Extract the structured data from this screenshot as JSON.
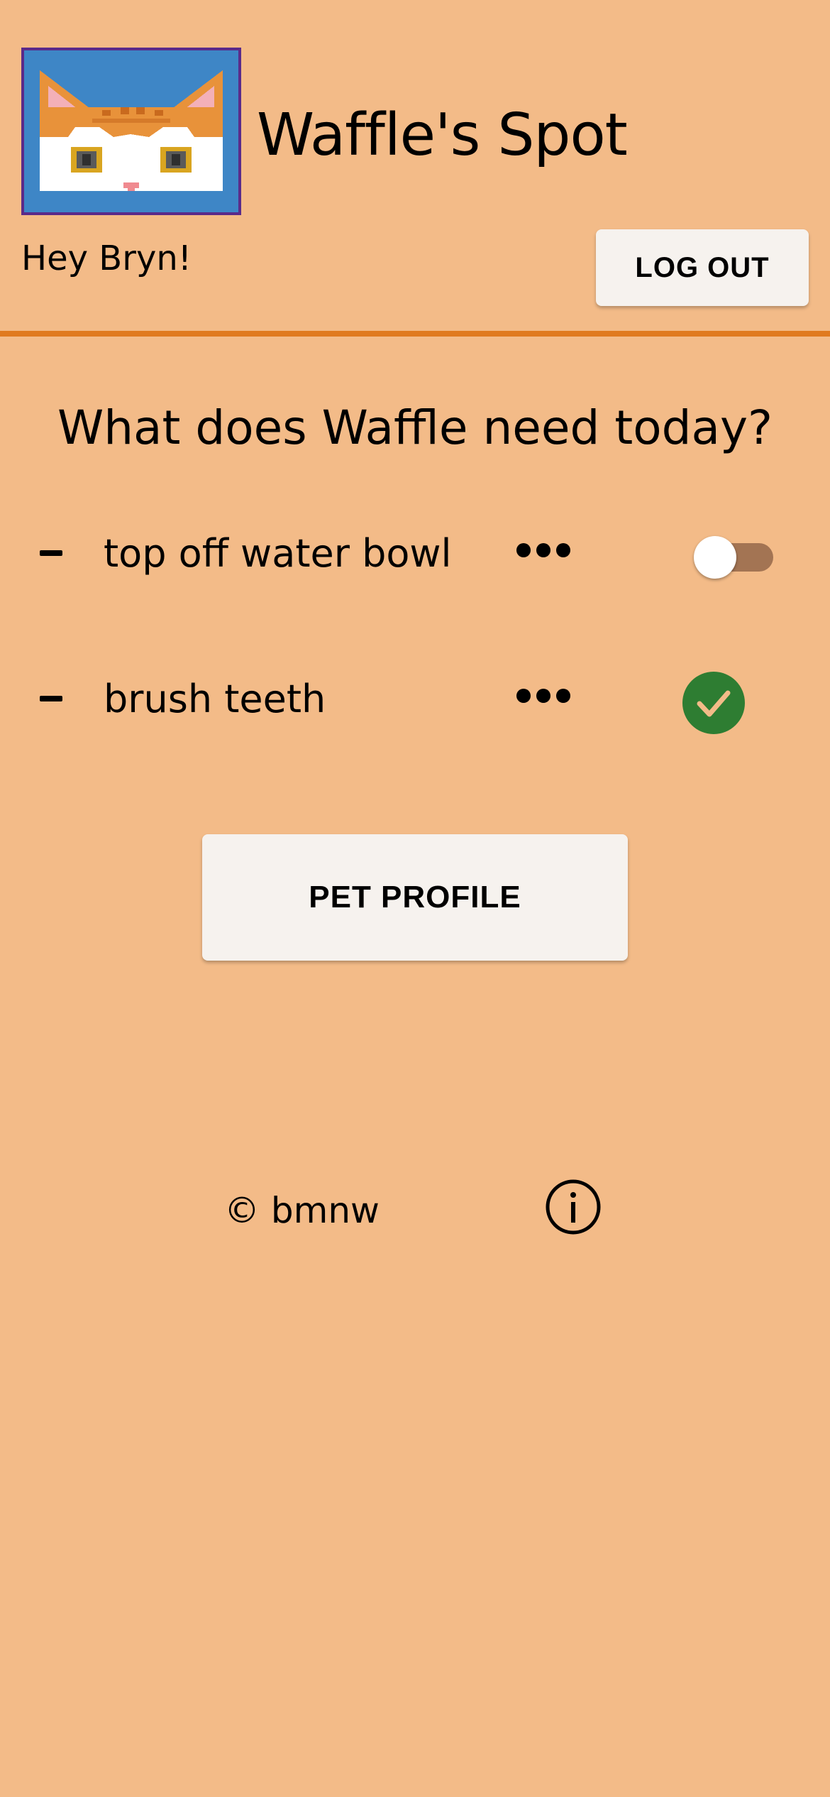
{
  "header": {
    "title": "Waffle's Spot",
    "greeting": "Hey Bryn!",
    "logout_label": "LOG OUT",
    "logo_icon": "pixel-cat-logo-icon"
  },
  "main": {
    "question": "What does Waffle need today?",
    "tasks": [
      {
        "label": "top off water bowl",
        "status": "toggle-off"
      },
      {
        "label": "brush teeth",
        "status": "done"
      }
    ],
    "pet_profile_label": "PET PROFILE"
  },
  "footer": {
    "copyright": "© bmnw",
    "info_icon": "info-icon"
  },
  "colors": {
    "background": "#F3BB88",
    "accent_divider": "#E07A1F",
    "button_bg": "#F6F2EE",
    "done_green": "#2E7D32",
    "toggle_track": "#A37453",
    "logo_bg": "#3E86C6"
  }
}
